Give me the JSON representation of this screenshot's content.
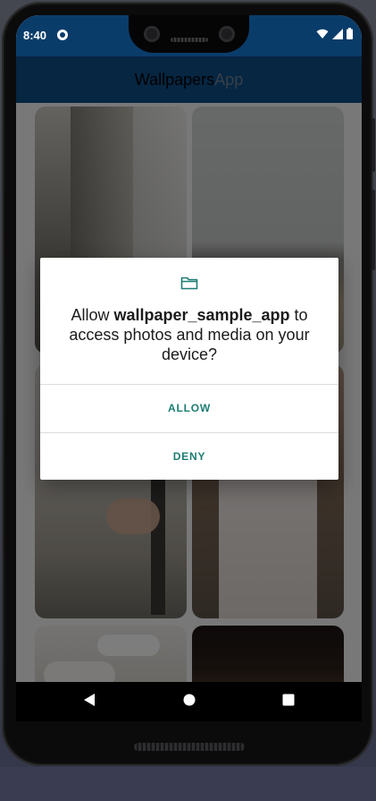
{
  "status_bar": {
    "time": "8:40",
    "icons": [
      "app-notification-icon",
      "wifi-icon",
      "cellular-signal-icon",
      "battery-icon"
    ]
  },
  "app_bar": {
    "title_part1": "Wallpapers",
    "title_part2": "App"
  },
  "dialog": {
    "icon": "folder-icon",
    "message_prefix": "Allow ",
    "app_name": "wallpaper_sample_app",
    "message_suffix": " to access photos and media on your device?",
    "allow_label": "ALLOW",
    "deny_label": "DENY"
  },
  "nav_bar": {
    "buttons": [
      "back-icon",
      "home-icon",
      "recents-icon"
    ]
  },
  "colors": {
    "app_bar": "#0d4d84",
    "status_bar": "#0a3c6a",
    "dialog_button_text": "#1d7d74",
    "scrim": "rgba(0,0,0,0.5)"
  }
}
